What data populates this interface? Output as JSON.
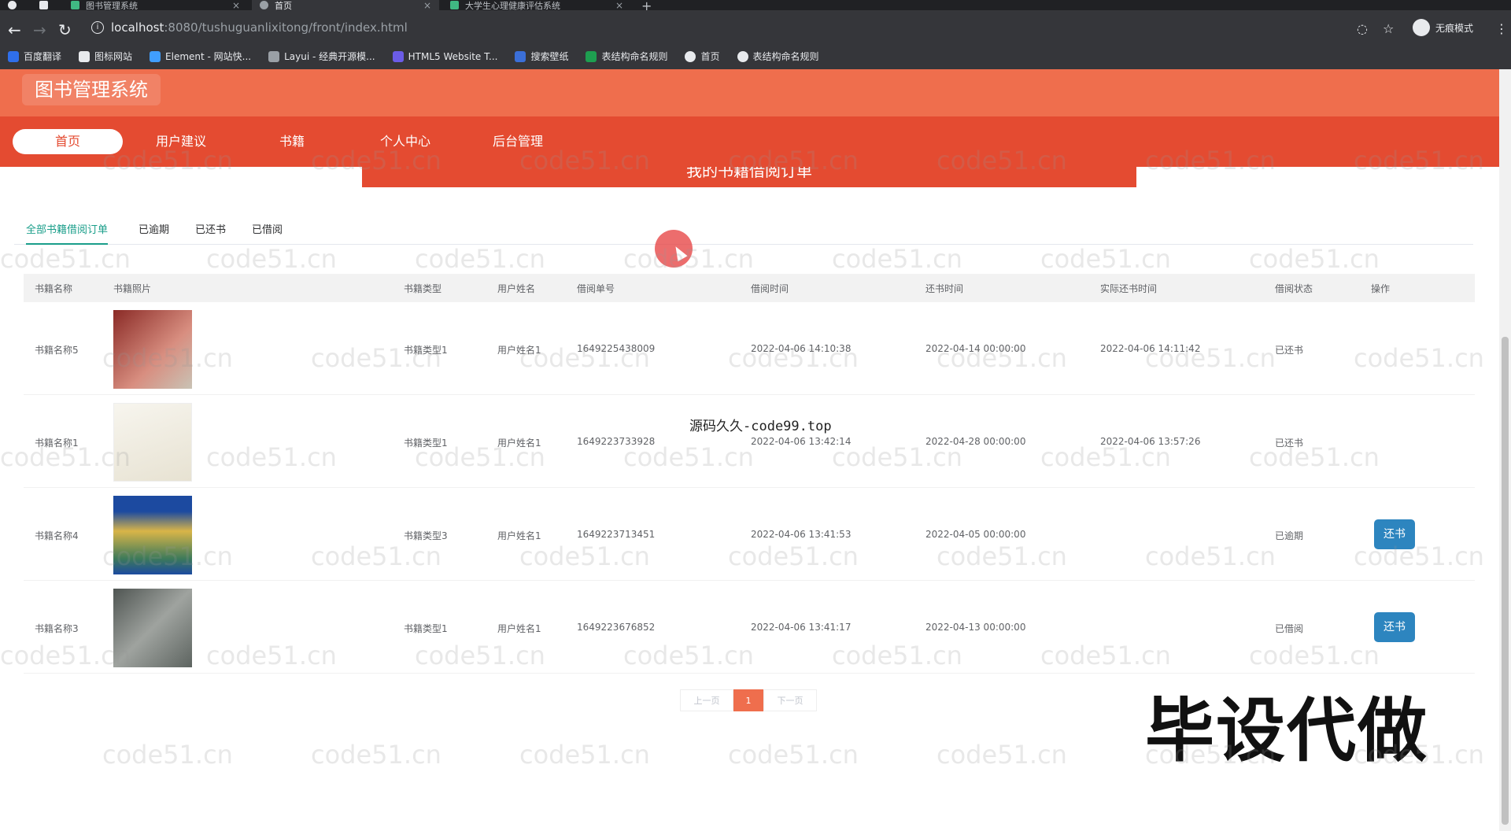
{
  "browser": {
    "tabs": [
      {
        "title": "图书管理系统",
        "color": "#40b883"
      },
      {
        "title": "首页",
        "color": "#9aa0a6"
      },
      {
        "title": "大学生心理健康评估系统",
        "color": "#40b883"
      }
    ],
    "url_host": "localhost",
    "url_path": ":8080/tushuguanlixitong/front/index.html",
    "incognito_label": "无痕模式",
    "bookmarks": [
      {
        "label": "百度翻译",
        "color": "#2f6fea"
      },
      {
        "label": "图标网站",
        "color": "#e8eaed"
      },
      {
        "label": "Element - 网站快...",
        "color": "#409eff"
      },
      {
        "label": "Layui - 经典开源模...",
        "color": "#9aa0a6"
      },
      {
        "label": "HTML5 Website T...",
        "color": "#6b5ce7"
      },
      {
        "label": "搜索壁纸",
        "color": "#3b6fd8"
      },
      {
        "label": "表结构命名规则",
        "color": "#1e9e50"
      },
      {
        "label": "首页",
        "color": "#e8eaed"
      },
      {
        "label": "表结构命名规则",
        "color": "#e8eaed"
      }
    ]
  },
  "site": {
    "title": "图书管理系统",
    "nav": [
      "首页",
      "用户建议",
      "书籍",
      "个人中心",
      "后台管理"
    ],
    "ribbon": "我的书籍借阅订单"
  },
  "tabs": [
    "全部书籍借阅订单",
    "已逾期",
    "已还书",
    "已借阅"
  ],
  "table": {
    "headers": [
      "书籍名称",
      "书籍照片",
      "书籍类型",
      "用户姓名",
      "借阅单号",
      "借阅时间",
      "还书时间",
      "实际还书时间",
      "借阅状态",
      "操作"
    ],
    "rows": [
      {
        "name": "书籍名称5",
        "type": "书籍类型1",
        "user": "用户姓名1",
        "order": "1649225438009",
        "borrow": "2022-04-06 14:10:38",
        "due": "2022-04-14 00:00:00",
        "actual": "2022-04-06 14:11:42",
        "status": "已还书",
        "action": "",
        "cover": "#b3302c"
      },
      {
        "name": "书籍名称1",
        "type": "书籍类型1",
        "user": "用户姓名1",
        "order": "1649223733928",
        "borrow": "2022-04-06 13:42:14",
        "due": "2022-04-28 00:00:00",
        "actual": "2022-04-06 13:57:26",
        "status": "已还书",
        "action": "",
        "cover": "#f2efe6"
      },
      {
        "name": "书籍名称4",
        "type": "书籍类型3",
        "user": "用户姓名1",
        "order": "1649223713451",
        "borrow": "2022-04-06 13:41:53",
        "due": "2022-04-05 00:00:00",
        "actual": "",
        "status": "已逾期",
        "action": "还书",
        "cover": "#1c4aa0"
      },
      {
        "name": "书籍名称3",
        "type": "书籍类型1",
        "user": "用户姓名1",
        "order": "1649223676852",
        "borrow": "2022-04-06 13:41:17",
        "due": "2022-04-13 00:00:00",
        "actual": "",
        "status": "已借阅",
        "action": "还书",
        "cover": "#6e7370"
      }
    ]
  },
  "pagination": {
    "prev": "上一页",
    "current": "1",
    "next": "下一页"
  },
  "overlay": {
    "big_text": "毕设代做",
    "mid_text": "源码久久-code99.top",
    "watermark": "code51.cn"
  }
}
